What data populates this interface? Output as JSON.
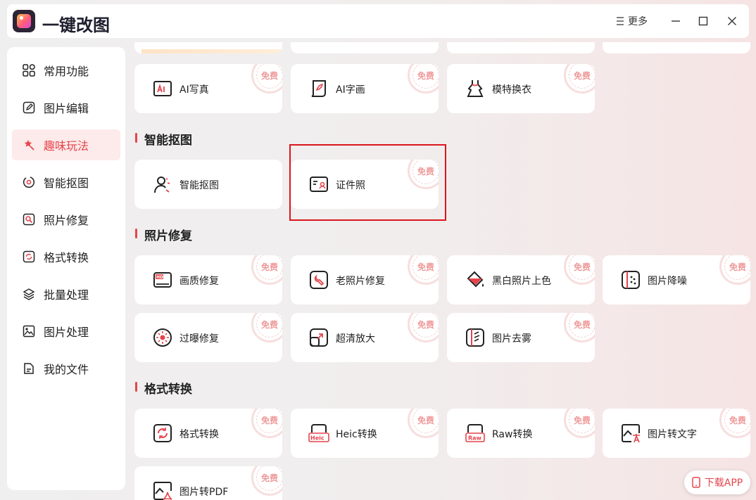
{
  "app": {
    "title": "一键改图",
    "more_label": "更多"
  },
  "sidebar": {
    "items": [
      {
        "label": "常用功能",
        "icon": "grid-icon"
      },
      {
        "label": "图片编辑",
        "icon": "edit-icon"
      },
      {
        "label": "趣味玩法",
        "icon": "magic-icon",
        "active": true
      },
      {
        "label": "智能抠图",
        "icon": "cutout-icon"
      },
      {
        "label": "照片修复",
        "icon": "repair-icon"
      },
      {
        "label": "格式转换",
        "icon": "convert-icon"
      },
      {
        "label": "批量处理",
        "icon": "layers-icon"
      },
      {
        "label": "图片处理",
        "icon": "image-icon"
      },
      {
        "label": "我的文件",
        "icon": "file-icon"
      }
    ]
  },
  "free_label": "免费",
  "fun": {
    "cards": [
      "AI写真",
      "AI字画",
      "模特换衣"
    ]
  },
  "cutout": {
    "title": "智能抠图",
    "cards": [
      "智能抠图",
      "证件照"
    ]
  },
  "repair": {
    "title": "照片修复",
    "cards": [
      "画质修复",
      "老照片修复",
      "黑白照片上色",
      "图片降噪",
      "过曝修复",
      "超清放大",
      "图片去雾"
    ]
  },
  "convert": {
    "title": "格式转换",
    "cards": [
      "格式转换",
      "Heic转换",
      "Raw转换",
      "图片转文字",
      "图片转PDF"
    ]
  },
  "icon_text": {
    "hd": "HD",
    "heic": "Heic",
    "raw": "Raw"
  },
  "download": {
    "label": "下载APP"
  },
  "colors": {
    "accent": "#e5454c",
    "highlight": "#d9161c"
  }
}
